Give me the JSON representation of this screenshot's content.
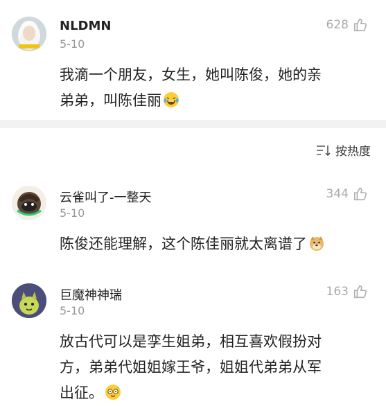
{
  "sort": {
    "label": "按热度"
  },
  "comments": [
    {
      "username": "NLDMN",
      "date": "5-10",
      "likes": "628",
      "text_line1": "我滴一个朋友，女生，她叫陈俊，她的亲",
      "text_line2": "弟弟，叫陈佳丽",
      "emoji": "laughing-tears-emoji"
    },
    {
      "username": "云雀叫了-一整天",
      "date": "5-10",
      "likes": "344",
      "text_line1": "陈俊还能理解，这个陈佳丽就太离谱了",
      "emoji": "doge-emoji"
    },
    {
      "username": "巨魔神神瑞",
      "date": "5-10",
      "likes": "163",
      "text_line1": "放古代可以是孪生姐弟，相互喜欢假扮对",
      "text_line2": "方，弟弟代姐姐嫁王爷，姐姐代弟弟从军",
      "text_line3": "出征。",
      "emoji": "sweat-smile-emoji"
    }
  ]
}
